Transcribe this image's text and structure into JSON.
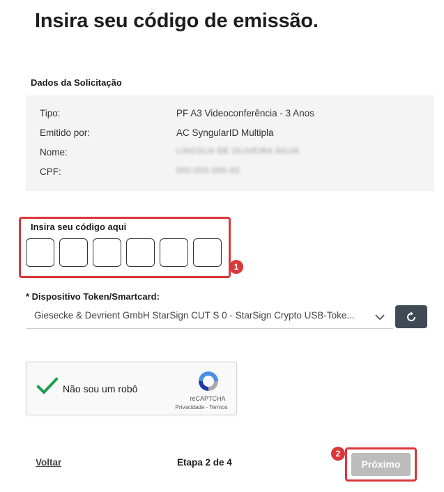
{
  "page": {
    "title": "Insira seu código de emissão."
  },
  "request": {
    "section_label": "Dados da Solicitação",
    "rows": [
      {
        "label": "Tipo:",
        "value": "PF A3 Videoconferência - 3 Anos"
      },
      {
        "label": "Emitido por:",
        "value": "AC SyngularID Multipla"
      },
      {
        "label": "Nome:",
        "value": "LINCOLN DE OLIVEIRA SILVA"
      },
      {
        "label": "CPF:",
        "value": "000.000.000-00"
      }
    ]
  },
  "code": {
    "label": "Insira seu código aqui",
    "badge": "1",
    "cells": [
      "",
      "",
      "",
      "",
      "",
      ""
    ]
  },
  "device": {
    "label": "* Dispositivo Token/Smartcard:",
    "selected": "Giesecke & Devrient GmbH StarSign CUT S 0 - StarSign Crypto USB-Toke...",
    "icon_chevron": "chevron-down-icon",
    "icon_refresh": "refresh-icon"
  },
  "captcha": {
    "text": "Não sou um robô",
    "brand": "reCAPTCHA",
    "privacy": "Privacidade",
    "separator": " - ",
    "terms": "Termos",
    "check_color": "#1e9e4f"
  },
  "footer": {
    "back": "Voltar",
    "step": "Etapa 2 de 4",
    "next": "Próximo",
    "badge": "2"
  },
  "colors": {
    "highlight": "#d9383a",
    "button_dark": "#3f4a54",
    "button_disabled": "#bcbcbc"
  }
}
